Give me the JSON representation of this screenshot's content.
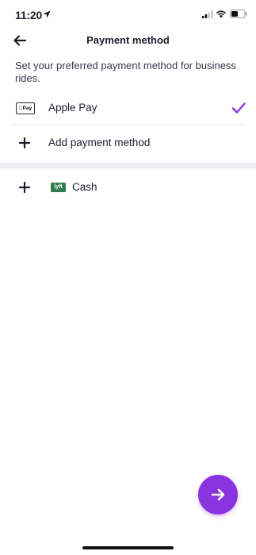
{
  "status_bar": {
    "time": "11:20"
  },
  "header": {
    "title": "Payment method",
    "back_icon": "arrow-left-icon"
  },
  "description": "Set your preferred payment method for business rides.",
  "payment_methods": [
    {
      "label": "Apple Pay",
      "badge": "Pay",
      "selected": true
    }
  ],
  "add_payment": {
    "label": "Add payment method",
    "icon": "plus-icon"
  },
  "cash": {
    "label": "Cash",
    "badge": "lyft",
    "icon": "plus-icon"
  },
  "fab": {
    "icon": "arrow-right-icon"
  },
  "colors": {
    "accent": "#8c33e0",
    "text": "#1f1d2b",
    "lyft_green": "#2e7d4f"
  }
}
